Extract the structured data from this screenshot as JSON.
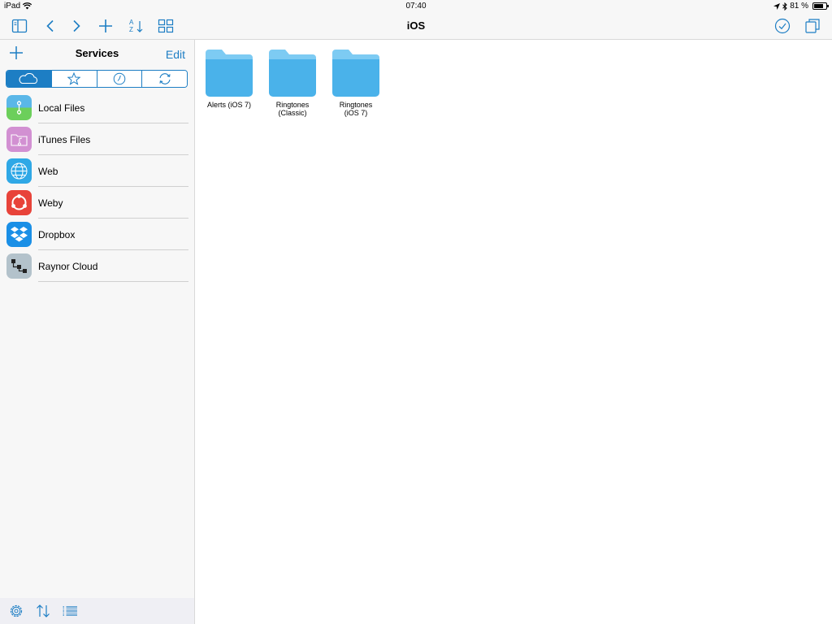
{
  "status": {
    "device": "iPad",
    "time": "07:40",
    "battery_text": "81 %",
    "battery_level": 0.81
  },
  "toolbar": {
    "title": "iOS",
    "sort_label_a": "A",
    "sort_label_z": "Z"
  },
  "sidebar": {
    "title": "Services",
    "edit_label": "Edit",
    "segments": [
      "cloud-icon",
      "star-icon",
      "clock-icon",
      "sync-icon"
    ],
    "services": [
      {
        "label": "Local Files",
        "icon": "local-files-icon",
        "color": "#7fc8e8"
      },
      {
        "label": "iTunes Files",
        "icon": "itunes-files-icon",
        "color": "#d08ed0"
      },
      {
        "label": "Web",
        "icon": "web-globe-icon",
        "color": "#2fa8e6"
      },
      {
        "label": "Weby",
        "icon": "weby-icon",
        "color": "#e8433a"
      },
      {
        "label": "Dropbox",
        "icon": "dropbox-icon",
        "color": "#1a8fe6"
      },
      {
        "label": "Raynor Cloud",
        "icon": "raynor-cloud-icon",
        "color": "#a9bac4"
      }
    ]
  },
  "folders": [
    {
      "label": "Alerts (iOS 7)"
    },
    {
      "label": "Ringtones\n(Classic)"
    },
    {
      "label": "Ringtones\n(iOS 7)"
    }
  ],
  "colors": {
    "accent": "#1d7ec4",
    "folder": "#4ab2ea",
    "folder_tab": "#7dcbf3"
  }
}
